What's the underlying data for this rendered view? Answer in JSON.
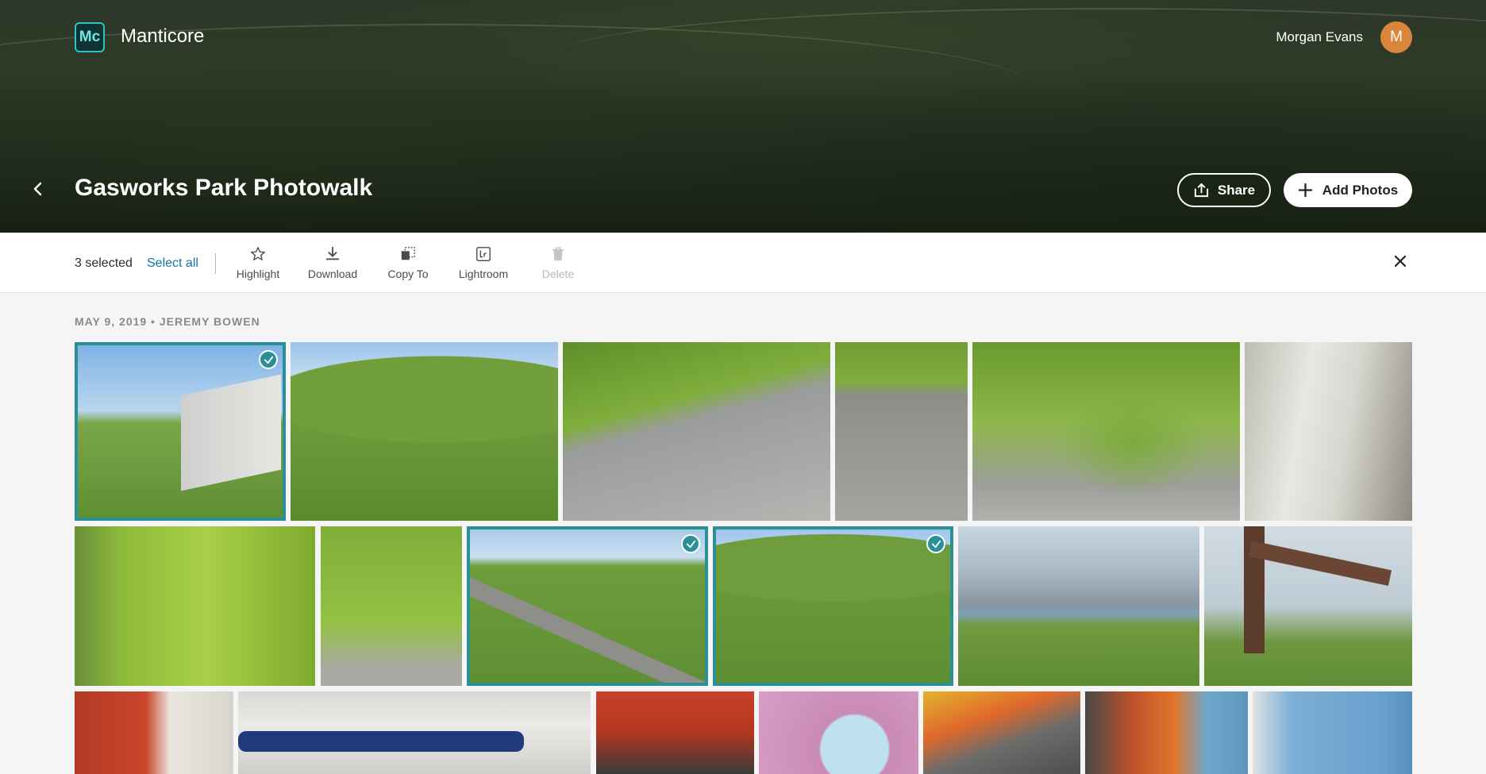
{
  "app": {
    "logo_text": "Mc",
    "name": "Manticore"
  },
  "user": {
    "name": "Morgan Evans",
    "initial": "M"
  },
  "album": {
    "title": "Gasworks Park Photowalk"
  },
  "header_actions": {
    "share_label": "Share",
    "add_photos_label": "Add Photos"
  },
  "toolbar": {
    "selected_text": "3 selected",
    "select_all_label": "Select all",
    "tools": [
      {
        "label": "Highlight",
        "icon": "star-icon",
        "enabled": true
      },
      {
        "label": "Download",
        "icon": "download-icon",
        "enabled": true
      },
      {
        "label": "Copy To",
        "icon": "copy-to-icon",
        "enabled": true
      },
      {
        "label": "Lightroom",
        "icon": "lightroom-icon",
        "enabled": true
      },
      {
        "label": "Delete",
        "icon": "trash-icon",
        "enabled": false
      }
    ]
  },
  "section": {
    "header": "MAY 9, 2019 • JEREMY BOWEN"
  },
  "colors": {
    "accent": "#2b8f97",
    "link": "#1473a8",
    "avatar": "#d9853b"
  },
  "photos": [
    {
      "row": 1,
      "subject": "grass hill with graffiti shed",
      "selected": true
    },
    {
      "row": 1,
      "subject": "grass hill with people on top",
      "selected": false
    },
    {
      "row": 1,
      "subject": "ivy on concrete wall",
      "selected": false
    },
    {
      "row": 1,
      "subject": "bare vines on concrete",
      "selected": false
    },
    {
      "row": 1,
      "subject": "ivy on concrete wall",
      "selected": false
    },
    {
      "row": 1,
      "subject": "peeling white paint",
      "selected": false
    },
    {
      "row": 2,
      "subject": "ivy hedge wall",
      "selected": false
    },
    {
      "row": 2,
      "subject": "ivy covered block",
      "selected": false
    },
    {
      "row": 2,
      "subject": "grass hill with path",
      "selected": true
    },
    {
      "row": 2,
      "subject": "grass hill",
      "selected": true
    },
    {
      "row": 2,
      "subject": "city skyline over hill",
      "selected": false
    },
    {
      "row": 2,
      "subject": "rusted industrial pipe",
      "selected": false
    },
    {
      "row": 3,
      "subject": "red industrial pipes",
      "selected": false
    },
    {
      "row": 3,
      "subject": "blue pipe on white machinery",
      "selected": false
    },
    {
      "row": 3,
      "subject": "red machinery wheel",
      "selected": false
    },
    {
      "row": 3,
      "subject": "pink painted machinery",
      "selected": false
    },
    {
      "row": 3,
      "subject": "yellow and red pipes",
      "selected": false
    },
    {
      "row": 3,
      "subject": "orange pipes and blue tank",
      "selected": false
    },
    {
      "row": 3,
      "subject": "blue riveted tank",
      "selected": false
    }
  ]
}
